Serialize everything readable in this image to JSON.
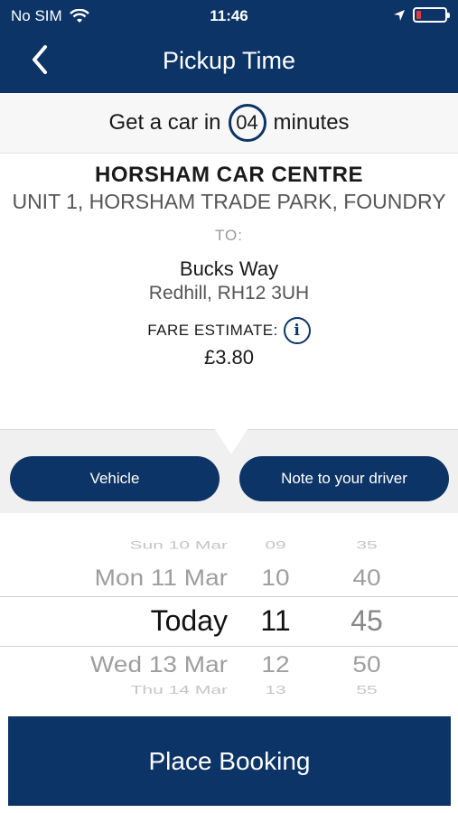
{
  "status_bar": {
    "carrier": "No SIM",
    "time": "11:46"
  },
  "header": {
    "title": "Pickup Time"
  },
  "eta": {
    "prefix": "Get a car in",
    "minutes": "04",
    "suffix": "minutes"
  },
  "pickup": {
    "name": "HORSHAM CAR CENTRE",
    "address": "UNIT 1, HORSHAM TRADE PARK, FOUNDRY"
  },
  "to_label": "TO:",
  "dropoff": {
    "name": "Bucks Way",
    "address": "Redhill, RH12 3UH"
  },
  "fare": {
    "label": "FARE ESTIMATE:",
    "value": "£3.80"
  },
  "buttons": {
    "vehicle": "Vehicle",
    "note": "Note to your driver",
    "place_booking": "Place Booking"
  },
  "picker": {
    "rows": [
      {
        "day": "Sun 10 Mar",
        "hour": "09",
        "minute": "35"
      },
      {
        "day": "Mon 11 Mar",
        "hour": "10",
        "minute": "40"
      },
      {
        "day": "Today",
        "hour": "11",
        "minute": "45"
      },
      {
        "day": "Wed 13 Mar",
        "hour": "12",
        "minute": "50"
      },
      {
        "day": "Thu 14 Mar",
        "hour": "13",
        "minute": "55"
      }
    ]
  },
  "colors": {
    "brand": "#0d3466",
    "battery_low": "#e23b3b"
  }
}
